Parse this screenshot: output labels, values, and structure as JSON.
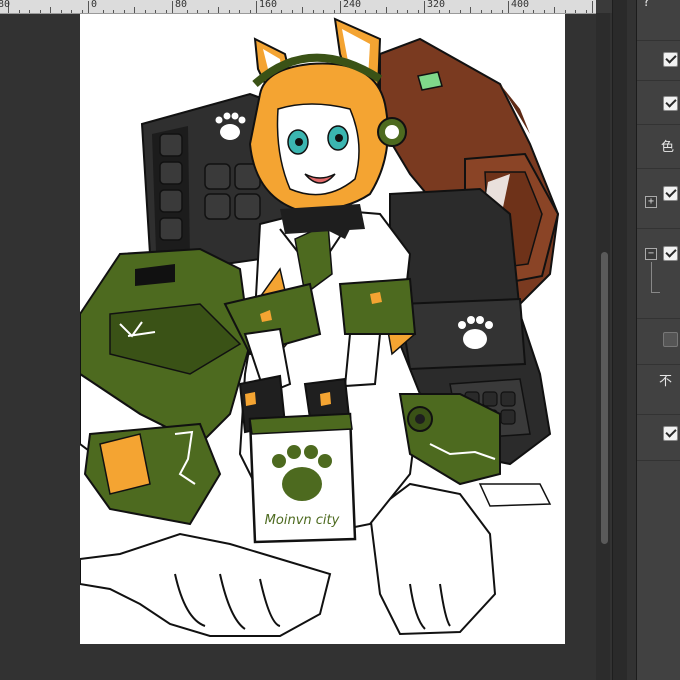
{
  "ruler": {
    "labels": [
      "80",
      "0",
      "80",
      "160",
      "240",
      "320",
      "400"
    ]
  },
  "artwork": {
    "board_text": "Moinvn city",
    "colors": {
      "accent_green": "#4d6a1f",
      "dark_green": "#3a5216",
      "brown": "#7a3a20",
      "orange": "#f4a432",
      "armor_dark": "#2f2f2f",
      "hud_green": "#7fd88a"
    },
    "icons": [
      "paw-icon",
      "paw-icon",
      "paw-icon",
      "paw-icon"
    ]
  },
  "panel": {
    "top_label": "?",
    "label_1": "色",
    "label_2": "不",
    "expand_plus": "+",
    "expand_minus": "−",
    "checkboxes": [
      true,
      true,
      true,
      true,
      false,
      true
    ]
  }
}
